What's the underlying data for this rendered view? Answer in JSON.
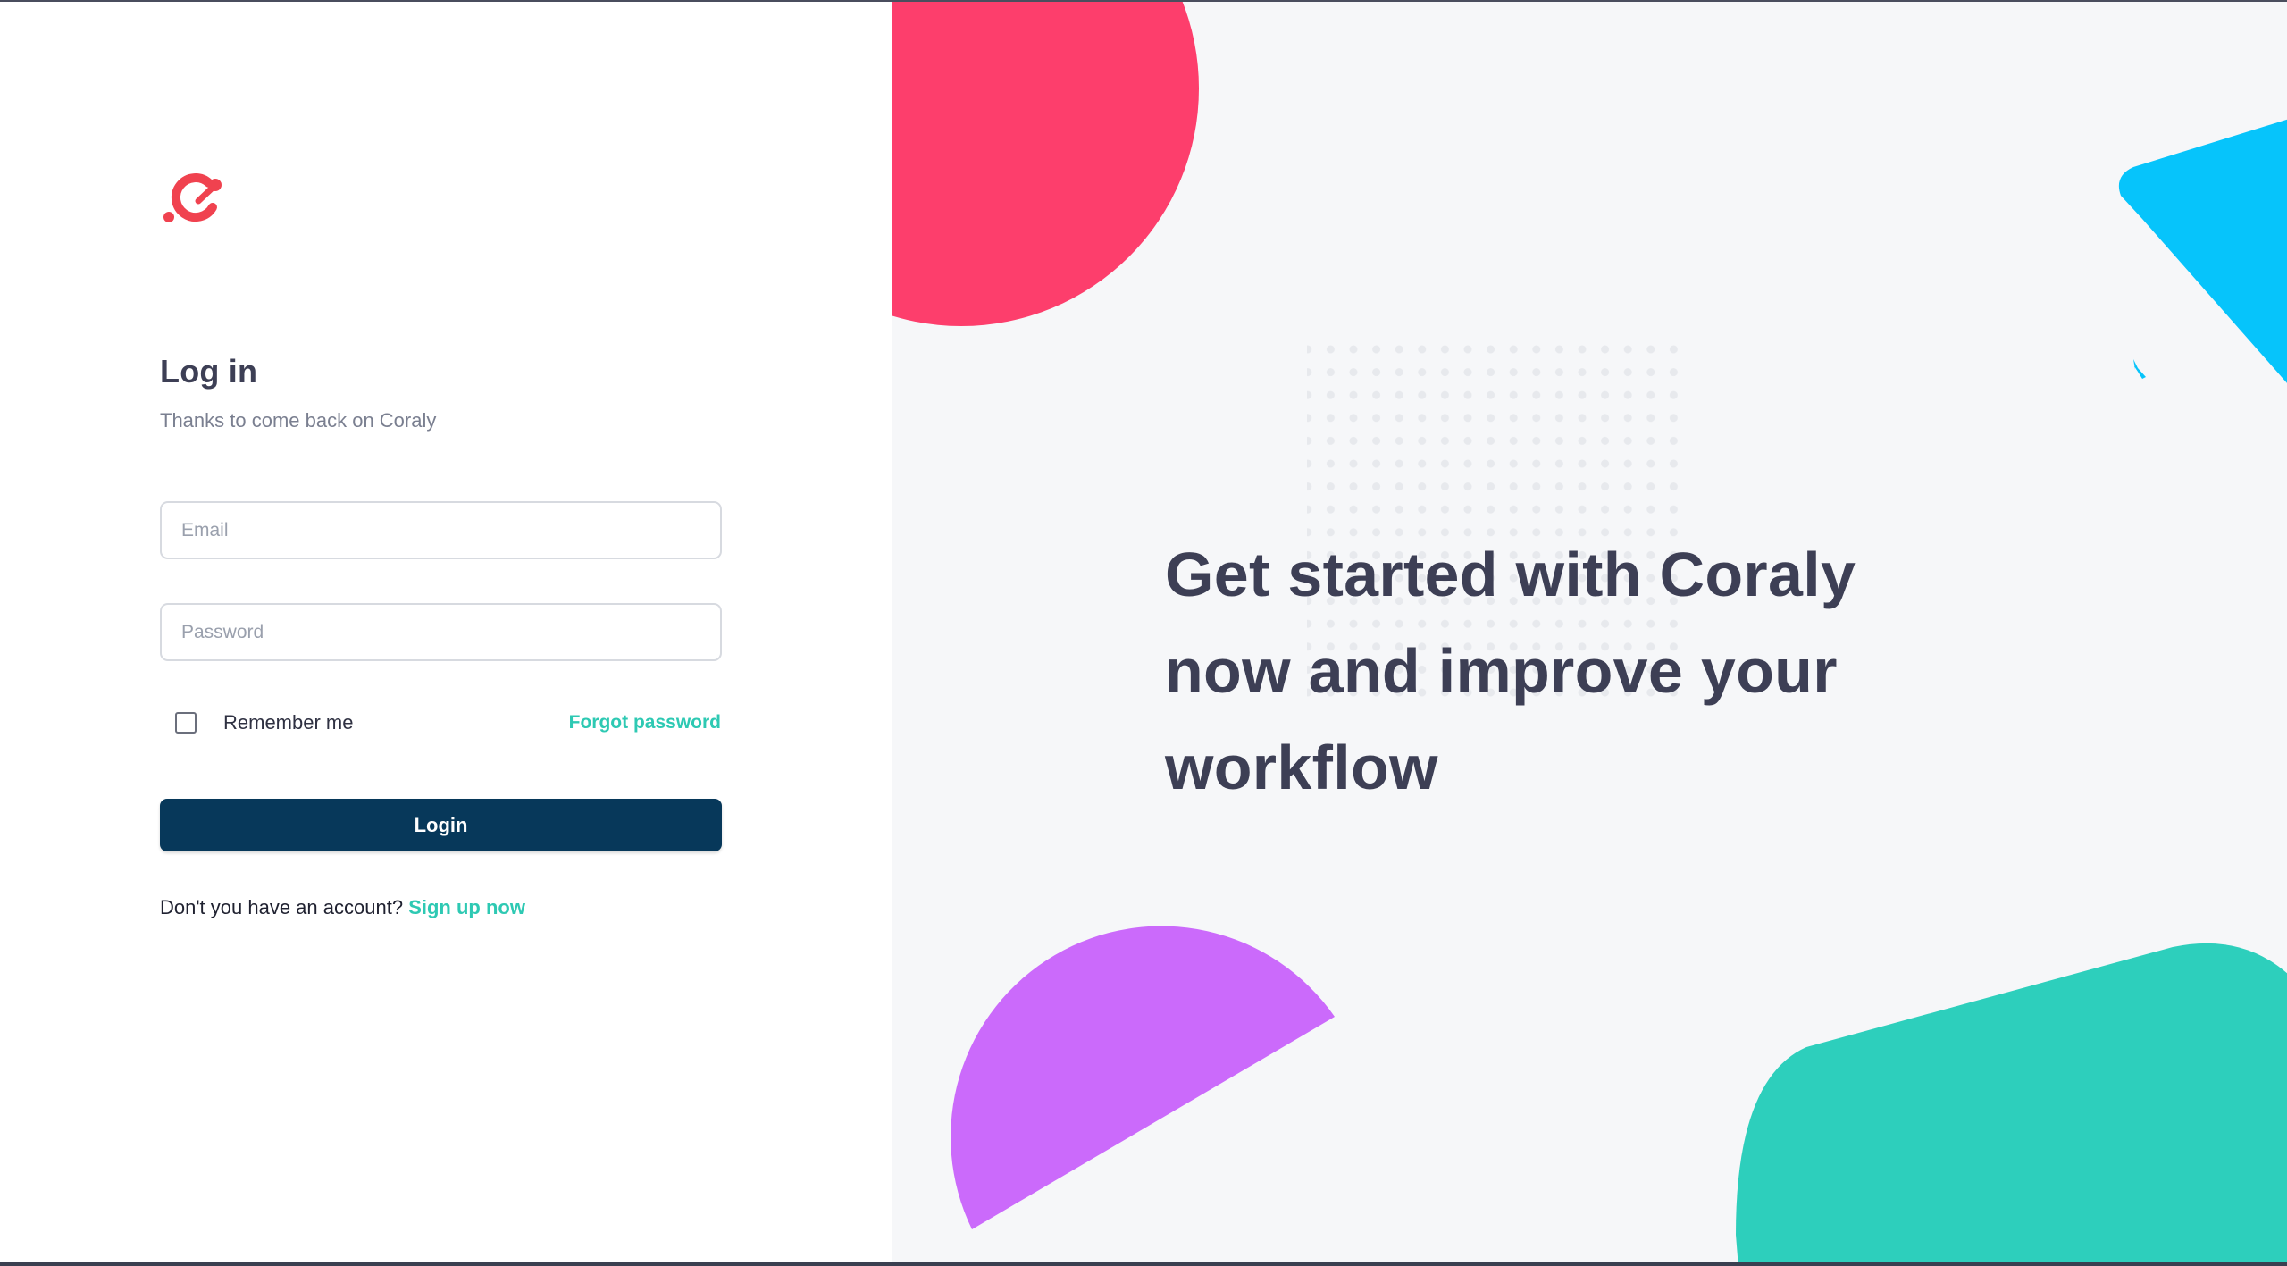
{
  "brand": {
    "logo_icon": "coraly-logo-icon",
    "accent_color": "#f0424f"
  },
  "login": {
    "title": "Log in",
    "subtitle": "Thanks to come back on Coraly",
    "email": {
      "placeholder": "Email",
      "value": ""
    },
    "password": {
      "placeholder": "Password",
      "value": ""
    },
    "remember_label": "Remember me",
    "remember_checked": false,
    "forgot_label": "Forgot password",
    "submit_label": "Login",
    "signup_prompt": "Don't you have an account?",
    "signup_link": "Sign up now"
  },
  "hero": {
    "headline": "Get started with Coraly now and improve your workflow"
  },
  "colors": {
    "primary_button": "#07385a",
    "link": "#2ec9b3",
    "text_dark": "#3d3f55",
    "shape_pink": "#fd3e6c",
    "shape_blue": "#06c4fb",
    "shape_purple": "#cb6afb",
    "shape_teal": "#2dcfbc",
    "hero_background": "#f6f7f9"
  }
}
